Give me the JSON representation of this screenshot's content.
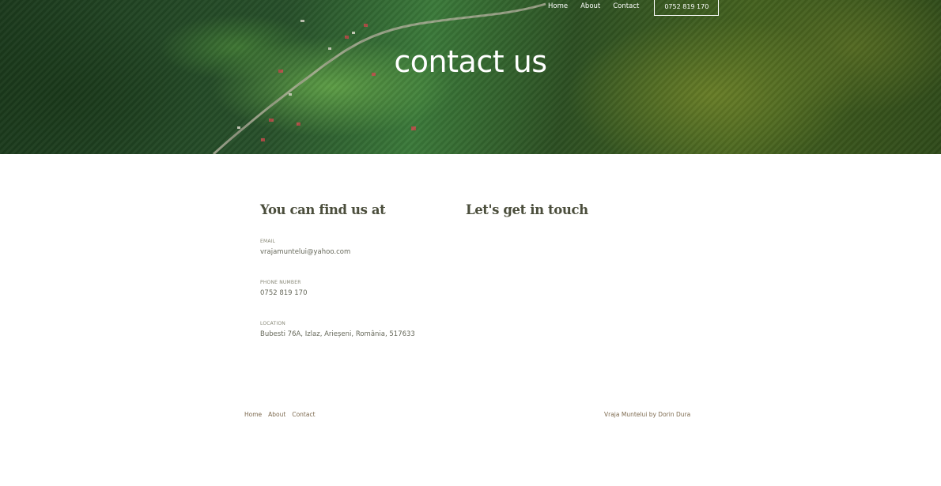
{
  "nav": {
    "items": [
      {
        "label": "Home"
      },
      {
        "label": "About"
      },
      {
        "label": "Contact"
      }
    ],
    "phone_button": "0752 819 170"
  },
  "hero": {
    "title": "contact us"
  },
  "find_us": {
    "heading": "You can find us at",
    "email_label": "EMAIL",
    "email_value": "vrajamuntelui@yahoo.com",
    "phone_label": "PHONE NUMBER",
    "phone_value": "0752 819 170",
    "location_label": "LOCATION",
    "location_value": "Bubesti 76A, Izlaz, Arieșeni, România, 517633"
  },
  "touch": {
    "heading": "Let's get in touch"
  },
  "footer": {
    "nav": [
      {
        "label": "Home"
      },
      {
        "label": "About"
      },
      {
        "label": "Contact"
      }
    ],
    "credit": "Vraja Muntelui by Dorin Dura"
  }
}
